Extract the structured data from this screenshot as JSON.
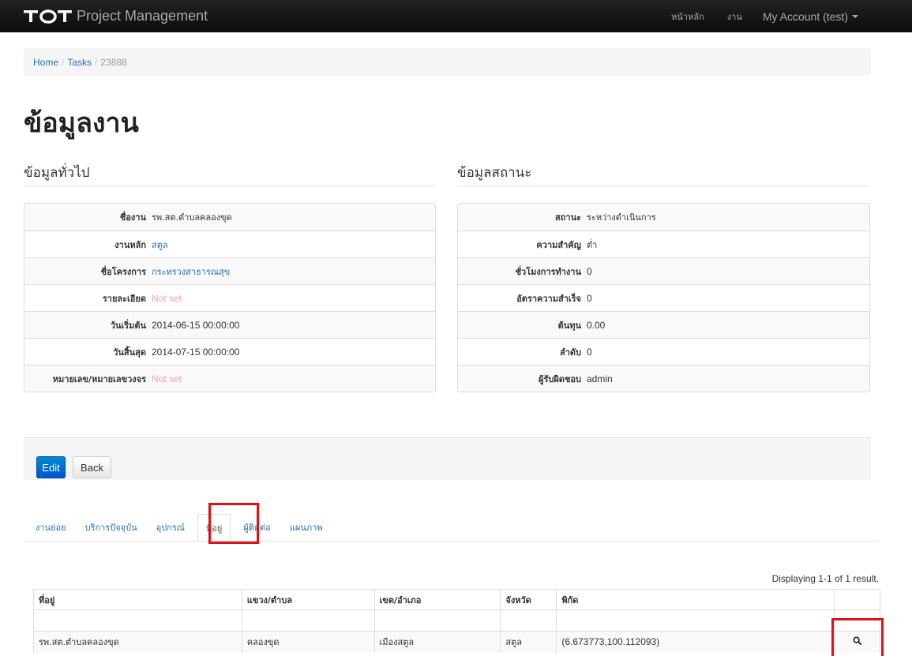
{
  "navbar": {
    "brand": "Project Management",
    "links": [
      "หน้าหลัก",
      "งาน"
    ],
    "account": "My Account (test)"
  },
  "breadcrumb": {
    "items": [
      "Home",
      "Tasks"
    ],
    "current": "23888"
  },
  "page_title": "ข้อมูลงาน",
  "general": {
    "title": "ข้อมูลทั่วไป",
    "rows": [
      {
        "label": "ชื่องาน",
        "value": "รพ.สต.ตำบลคลองขุด"
      },
      {
        "label": "งานหลัก",
        "value": "สตูล"
      },
      {
        "label": "ชื่อโครงการ",
        "value": "กระทรวงสาธารณสุข"
      },
      {
        "label": "รายละเอียด",
        "value": "Not set"
      },
      {
        "label": "วันเริ่มต้น",
        "value": "2014-06-15 00:00:00"
      },
      {
        "label": "วันสิ้นสุด",
        "value": "2014-07-15 00:00:00"
      },
      {
        "label": "หมายเลข/หมายเลขวงจร",
        "value": "Not set"
      }
    ]
  },
  "status": {
    "title": "ข้อมูลสถานะ",
    "rows": [
      {
        "label": "สถานะ",
        "value": "ระหว่างดำเนินการ"
      },
      {
        "label": "ความสำคัญ",
        "value": "ต่ำ"
      },
      {
        "label": "ชั่วโมงการทำงาน",
        "value": "0"
      },
      {
        "label": "อัตราความสำเร็จ",
        "value": "0"
      },
      {
        "label": "ต้นทุน",
        "value": "0.00"
      },
      {
        "label": "ลำดับ",
        "value": "0"
      },
      {
        "label": "ผู้รับผิดชอบ",
        "value": "admin"
      }
    ]
  },
  "buttons": {
    "edit": "Edit",
    "back": "Back"
  },
  "tabs": [
    "งานย่อย",
    "บริการปัจจุบัน",
    "อุปกรณ์",
    "ที่อยู่",
    "ผู้ติดต่อ",
    "แผนภาพ"
  ],
  "summary": "Displaying 1-1 of 1 result.",
  "grid": {
    "headers": [
      "ที่อยู่",
      "แขวง/ตำบล",
      "เขต/อำเภอ",
      "จังหวัด",
      "พิกัด",
      ""
    ],
    "rows": [
      [
        "รพ.สต.ตำบลคลองขุด",
        "คลองขุด",
        "เมืองสตูล",
        "สตูล",
        "(6.673773,100.112093)"
      ]
    ]
  },
  "colors": {
    "navbar": "#111111",
    "link": "#2a6fb0",
    "notset": "#f5a3b2",
    "primary": "#0066cc",
    "highlight": "#e0101a"
  },
  "icons": {
    "view": "search-icon"
  }
}
